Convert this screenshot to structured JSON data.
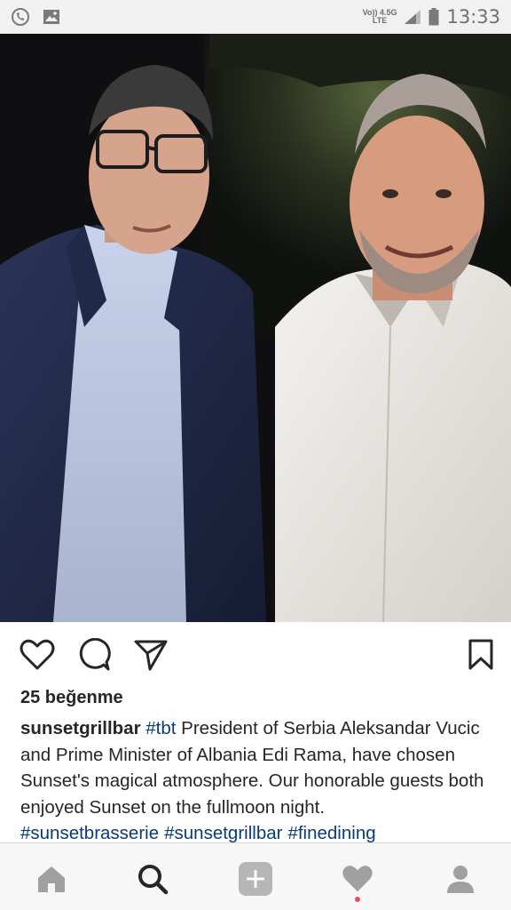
{
  "status_bar": {
    "network_line1": "Vo)) 4.5G",
    "network_line2": "LTE",
    "time": "13:33",
    "icons": [
      "whatsapp-icon",
      "gallery-icon",
      "signal-icon",
      "battery-icon"
    ]
  },
  "post": {
    "photo_description_icon": "photo",
    "likes": "25 beğenme",
    "username": "sunsetgrillbar",
    "first_hashtag": "#tbt",
    "caption_text": " President of Serbia Aleksandar Vucic and Prime Minister of Albania Edi Rama, have chosen Sunset's magical atmosphere.  Our honorable guests both enjoyed Sunset on the fullmoon night.",
    "hashtags": [
      "#sunsetbrasserie",
      "#sunsetgrillbar",
      "#finedining"
    ]
  },
  "actions": [
    "like-icon",
    "comment-icon",
    "share-icon",
    "save-icon"
  ],
  "bottom_nav": [
    "home-icon",
    "search-icon",
    "add-icon",
    "activity-icon",
    "profile-icon"
  ],
  "colors": {
    "hashtag": "#0a3a78",
    "activity_dot": "#ed4956",
    "status_bg": "#f1f1f1"
  }
}
